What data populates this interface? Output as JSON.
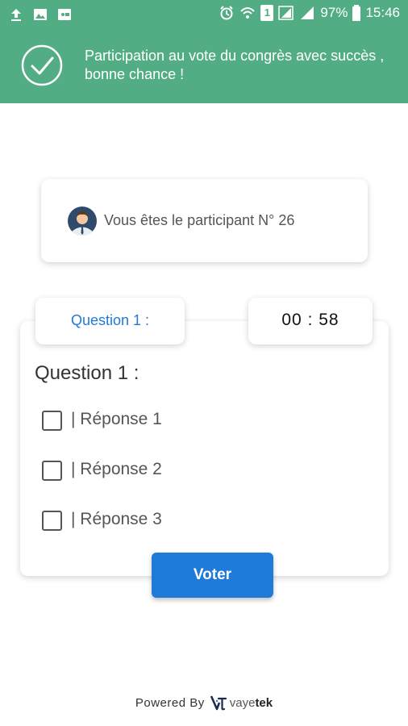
{
  "status_bar": {
    "battery": "97%",
    "time": "15:46",
    "sim": "1",
    "left_icons": [
      "upload-icon",
      "image-icon",
      "screencast-icon"
    ],
    "right_icons": [
      "alarm-icon",
      "wifi-icon",
      "sim-icon",
      "signal-icon",
      "signal-icon",
      "battery-icon"
    ]
  },
  "banner": {
    "message": "Participation au vote du congrès avec succès , bonne chance !",
    "icon": "check-circle-icon",
    "color": "#52ad85"
  },
  "participant": {
    "text": "Vous êtes le participant N° 26",
    "icon": "avatar-icon"
  },
  "question": {
    "tab_label": "Question 1 :",
    "timer": "00 : 58",
    "title": "Question 1 :",
    "answers": [
      {
        "label": "| Réponse 1",
        "checked": false
      },
      {
        "label": "| Réponse 2",
        "checked": false
      },
      {
        "label": "| Réponse 3",
        "checked": false
      }
    ]
  },
  "vote_button": {
    "label": "Voter",
    "color": "#1f7ad9"
  },
  "footer": {
    "powered_by": "Powered By",
    "brand_prefix": "vaye",
    "brand_suffix": "tek"
  }
}
